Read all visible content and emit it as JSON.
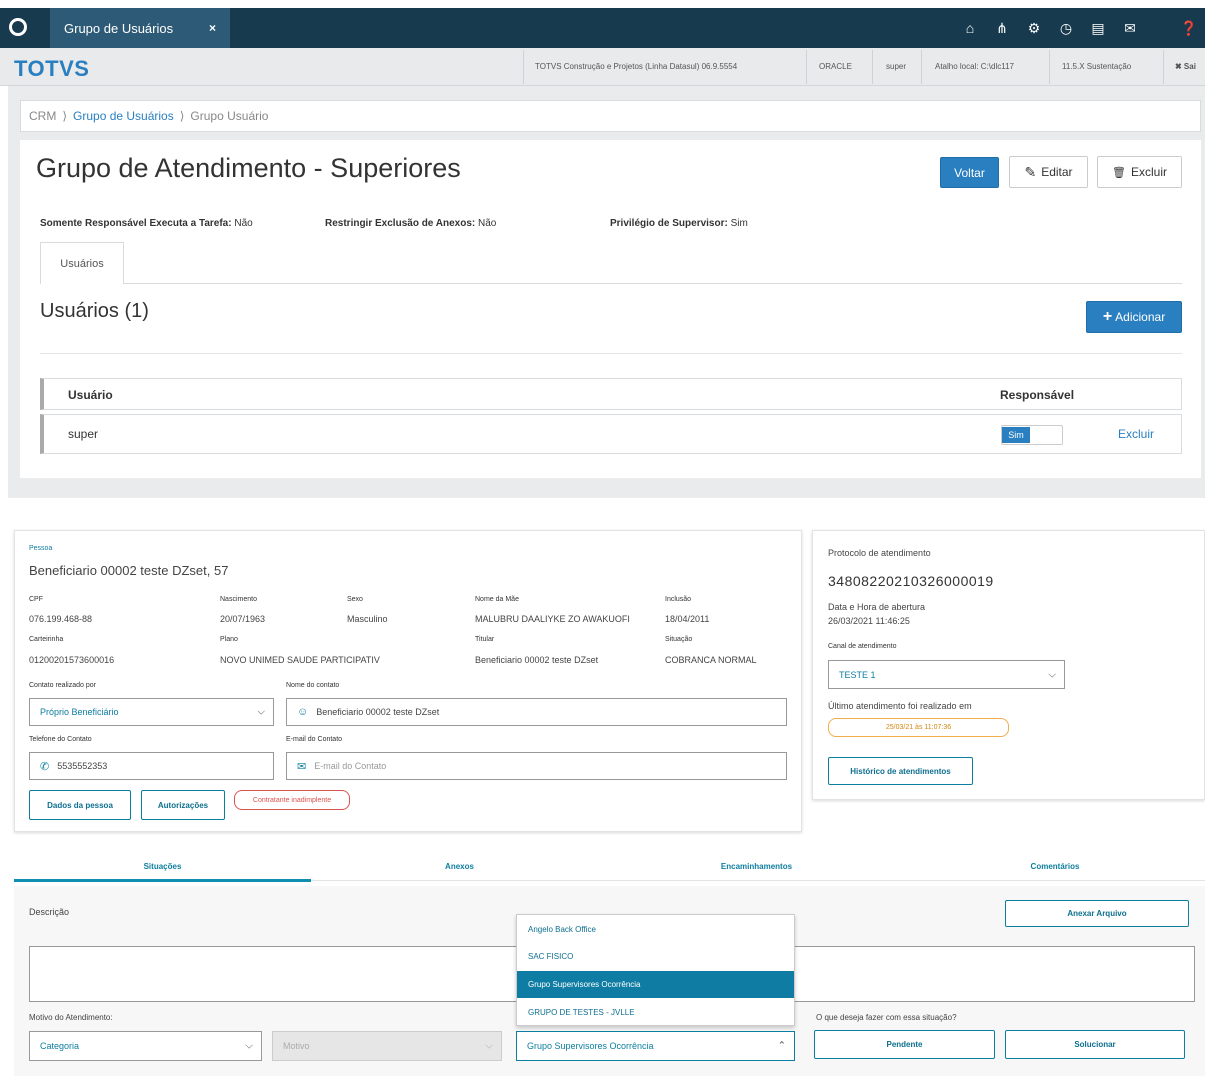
{
  "topbar": {
    "tab_label": "Grupo de Usuários",
    "tab_close": "×",
    "icons": [
      "home-icon",
      "sitemap-icon",
      "gear-icon",
      "clock-icon",
      "document-icon",
      "mail-icon",
      "help-icon"
    ],
    "icon_glyphs": [
      "⌂",
      "⋔",
      "⚙",
      "◷",
      "▤",
      "✉",
      "❓"
    ]
  },
  "header": {
    "brand": "TOTVS",
    "company": "TOTVS Construção e Projetos (Linha Datasul) 06.9.5554",
    "database": "ORACLE",
    "user": "super",
    "shortcut": "Atalho local: C:\\dlc117",
    "version": "11.5.X Sustentação",
    "exit": "✖ Sai"
  },
  "breadcrumb": {
    "crm": "CRM",
    "sep1": "⟩",
    "groups": "Grupo de Usuários",
    "sep2": "⟩",
    "current": "Grupo Usuário"
  },
  "group": {
    "title": "Grupo de Atendimento - Superiores",
    "btn_back": "Voltar",
    "btn_edit": "Editar",
    "btn_delete": "Excluir",
    "edit_icon": "✎",
    "delete_icon": "🗑",
    "meta1_label": "Somente Responsável Executa a Tarefa:",
    "meta1_value": "Não",
    "meta2_label": "Restringir Exclusão de Anexos:",
    "meta2_value": "Não",
    "meta3_label": "Privilégio de Supervisor:",
    "meta3_value": "Sim",
    "tab": "Usuários",
    "users_title": "Usuários (1)",
    "btn_add": "Adicionar",
    "add_icon": "+"
  },
  "users_table": {
    "col_user": "Usuário",
    "col_resp": "Responsável",
    "rows": [
      {
        "user": "super",
        "toggle": "Sim",
        "action": "Excluir"
      }
    ]
  },
  "person": {
    "section": "Pessoa",
    "name": "Beneficiario 00002 teste DZset, 57",
    "cpf_label": "CPF",
    "cpf": "076.199.468-88",
    "birth_label": "Nascimento",
    "birth": "20/07/1963",
    "sex_label": "Sexo",
    "sex": "Masculino",
    "mother_label": "Nome da Mãe",
    "mother": "MALUBRU DAALIYKE ZO AWAKUOFI",
    "inclusion_label": "Inclusão",
    "inclusion": "18/04/2011",
    "card_label": "Carteirinha",
    "card": "01200201573600016",
    "plan_label": "Plano",
    "plan": "NOVO UNIMED SAUDE PARTICIPATIV",
    "holder_label": "Titular",
    "holder": "Beneficiario 00002 teste DZset",
    "status_label": "Situação",
    "status": "COBRANCA NORMAL",
    "contact_by_label": "Contato realizado por",
    "contact_by": "Próprio Beneficiário",
    "contact_name_label": "Nome do contato",
    "contact_name": "Beneficiario 00002 teste DZset",
    "phone_label": "Telefone do Contato",
    "phone": "5535552353",
    "email_label": "E-mail do Contato",
    "email_placeholder": "E-mail do Contato",
    "btn_data": "Dados da pessoa",
    "btn_auth": "Autorizações",
    "badge": "Contratante inadimplente"
  },
  "protocol": {
    "label": "Protocolo de atendimento",
    "number": "34808220210326000019",
    "opened_label": "Data e Hora de abertura",
    "opened": "26/03/2021 11:46:25",
    "channel_label": "Canal de atendimento",
    "channel": "TESTE 1",
    "last_label": "Último atendimento foi realizado em",
    "last": "25/03/21 às 11:07:36",
    "btn_history": "Histórico de atendimentos"
  },
  "tabs2": [
    "Situações",
    "Anexos",
    "Encaminhamentos",
    "Comentários"
  ],
  "situation": {
    "desc_label": "Descrição",
    "btn_attach": "Anexar Arquivo",
    "reason_label": "Motivo do Atendimento:",
    "category": "Categoria",
    "reason_placeholder": "Motivo",
    "group_selected": "Grupo Supervisores Ocorrência",
    "question": "O que deseja fazer com essa situação?",
    "btn_pending": "Pendente",
    "btn_solve": "Solucionar",
    "dropdown": [
      "Angelo Back Office",
      "SAC FISICO",
      "Grupo Supervisores Ocorrência",
      "GRUPO DE TESTES - JVLLE"
    ]
  },
  "colors": {
    "primary": "#2a7fc0",
    "navy": "#173a4f",
    "teal": "#0d7ea0",
    "highlight": "#0f7da3",
    "danger": "#d9534f",
    "warning": "#f0ad4e"
  }
}
